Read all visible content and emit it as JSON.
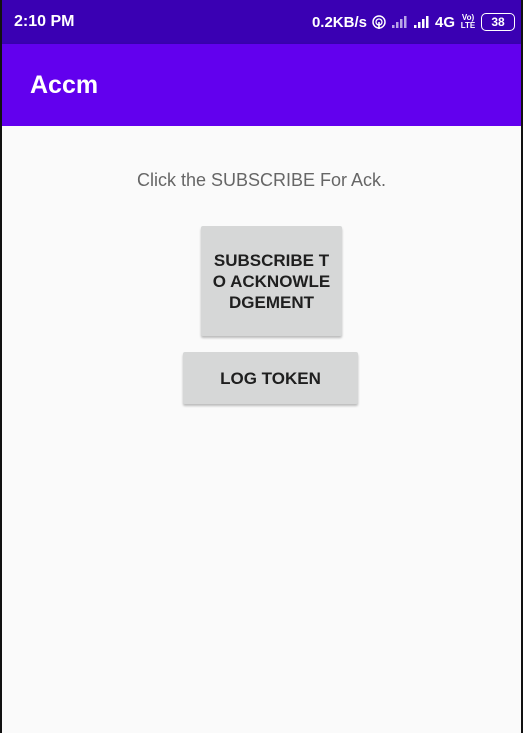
{
  "status_bar": {
    "time": "2:10 PM",
    "network_speed": "0.2KB/s",
    "network_type": "4G",
    "volte": "Vo) LTE",
    "battery": "38",
    "icons": [
      "hotspot-icon",
      "signal-icon",
      "signal-icon",
      "volte-icon",
      "battery-icon"
    ]
  },
  "app_bar": {
    "title": "Accm"
  },
  "main": {
    "instruction": "Click the SUBSCRIBE For Ack.",
    "subscribe_button": "SUBSCRIBE TO ACKNOWLEDGEMENT",
    "log_token_button": "LOG TOKEN"
  },
  "colors": {
    "status_bar": "#3a00b3",
    "app_bar": "#6200ee",
    "background": "#fafafa",
    "button": "#d6d7d7",
    "text_primary": "#1f1f1f",
    "text_secondary": "#666666"
  }
}
